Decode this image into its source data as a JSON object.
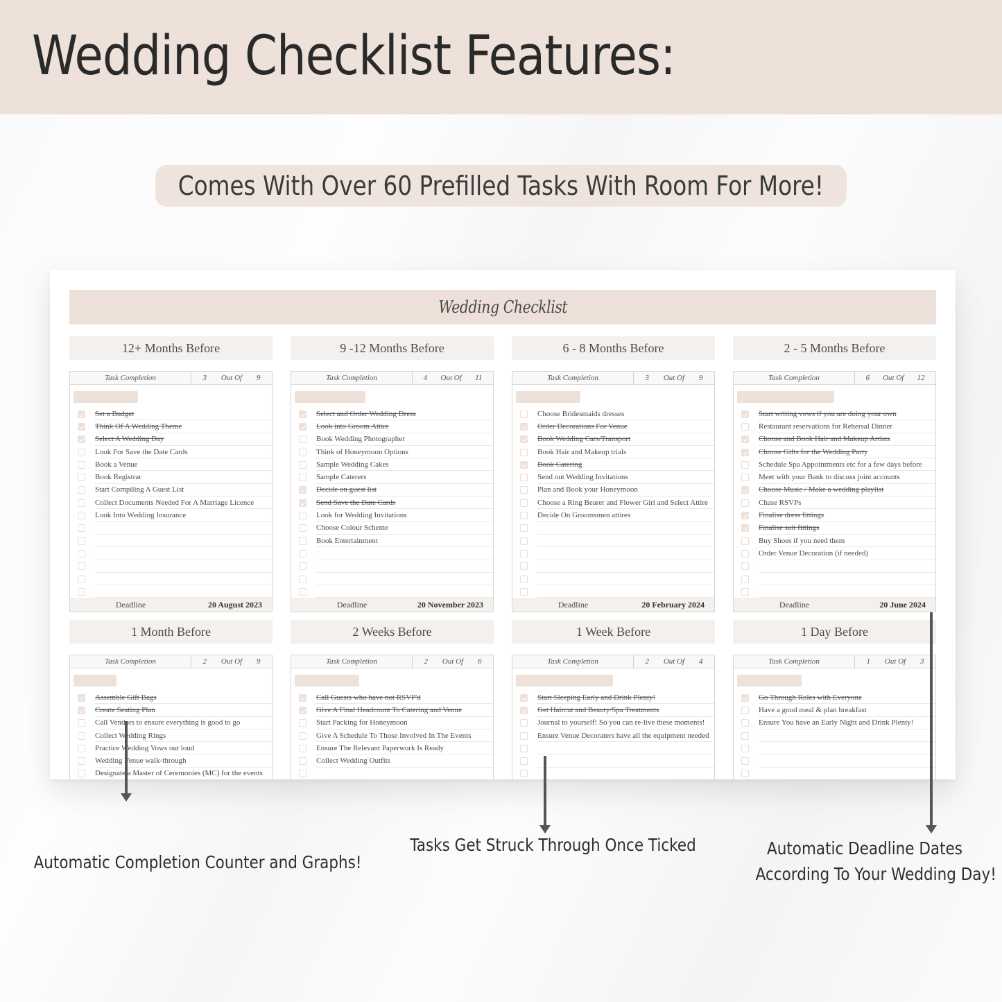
{
  "header": {
    "title": "Wedding Checklist Features:",
    "subtitle": "Comes With Over 60 Prefilled Tasks With Room For More!"
  },
  "sheet": {
    "title": "Wedding Checklist",
    "task_completion_label": "Task Completion",
    "out_of_label": "Out Of",
    "deadline_label": "Deadline",
    "sections": [
      {
        "title": "12+ Months Before",
        "done": 3,
        "total": 9,
        "deadline": "20 August 2023",
        "rows": 15,
        "tasks": [
          {
            "text": "Set a Budget",
            "done": true
          },
          {
            "text": "Think Of A Wedding Theme",
            "done": true
          },
          {
            "text": "Select A Wedding Day",
            "done": true
          },
          {
            "text": "Look For Save the Date Cards",
            "done": false
          },
          {
            "text": "Book a Venue",
            "done": false
          },
          {
            "text": "Book Registrar",
            "done": false
          },
          {
            "text": "Start Compiling A Guest List",
            "done": false
          },
          {
            "text": "Collect Documents Needed For A Marriage Licence",
            "done": false
          },
          {
            "text": "Look Into Wedding Insurance",
            "done": false
          }
        ]
      },
      {
        "title": "9 -12 Months Before",
        "done": 4,
        "total": 11,
        "deadline": "20 November 2023",
        "rows": 15,
        "tasks": [
          {
            "text": "Select and Order Wedding Dress",
            "done": true
          },
          {
            "text": "Look into Groom Attire",
            "done": true
          },
          {
            "text": "Book Wedding Photographer",
            "done": false
          },
          {
            "text": "Think of Honeymoon Options",
            "done": false
          },
          {
            "text": "Sample Wedding Cakes",
            "done": false
          },
          {
            "text": "Sample Caterers",
            "done": false
          },
          {
            "text": "Decide on guest list",
            "done": true
          },
          {
            "text": "Send Save the Date Cards",
            "done": true
          },
          {
            "text": "Look for Wedding Invitations",
            "done": false
          },
          {
            "text": "Choose Colour Scheme",
            "done": false
          },
          {
            "text": "Book Entertainment",
            "done": false
          }
        ]
      },
      {
        "title": "6 - 8 Months Before",
        "done": 3,
        "total": 9,
        "deadline": "20 February 2024",
        "rows": 15,
        "tasks": [
          {
            "text": "Choose Bridesmaids dresses",
            "done": false
          },
          {
            "text": "Order Decorations For Venue",
            "done": true
          },
          {
            "text": "Book Wedding Cars/Transport",
            "done": true
          },
          {
            "text": "Book Hair and Makeup trials",
            "done": false
          },
          {
            "text": "Book Catering",
            "done": true
          },
          {
            "text": "Send out Wedding Invitations",
            "done": false
          },
          {
            "text": "Plan and Book your Honeymoon",
            "done": false
          },
          {
            "text": "Choose a Ring Bearer and Flower Girl and Select Attire",
            "done": false
          },
          {
            "text": "Decide On Groomsmen attires",
            "done": false
          }
        ]
      },
      {
        "title": "2 - 5 Months Before",
        "done": 6,
        "total": 12,
        "deadline": "20 June 2024",
        "rows": 15,
        "tasks": [
          {
            "text": "Start writing vows if you are doing your own",
            "done": true
          },
          {
            "text": "Restaurant reservations for Rehersal Dinner",
            "done": false
          },
          {
            "text": "Choose and Book Hair and Makeup Artists",
            "done": true
          },
          {
            "text": "Choose Gifts for the Wedding Party",
            "done": true
          },
          {
            "text": "Schedule Spa Appointments etc for a few days before",
            "done": false
          },
          {
            "text": "Meet with your Bank to discuss joint accounts",
            "done": false
          },
          {
            "text": "Choose Music / Make a wedding playlist",
            "done": true
          },
          {
            "text": "Chase RSVPs",
            "done": false
          },
          {
            "text": "Finalise dress fittings",
            "done": true
          },
          {
            "text": "Finalise suit fittings",
            "done": true
          },
          {
            "text": "Buy Shoes if you need them",
            "done": false
          },
          {
            "text": "Order Venue Decoration (if needed)",
            "done": false
          }
        ]
      },
      {
        "title": "1 Month Before",
        "done": 2,
        "total": 9,
        "rows": 7,
        "tasks": [
          {
            "text": "Assemble Gift Bags",
            "done": true
          },
          {
            "text": "Create Seating Plan",
            "done": true
          },
          {
            "text": "Call Vendors to ensure everything is good to go",
            "done": false
          },
          {
            "text": "Collect Wedding Rings",
            "done": false
          },
          {
            "text": "Practice Wedding Vows out loud",
            "done": false
          },
          {
            "text": "Wedding Venue walk-through",
            "done": false
          },
          {
            "text": "Designate a Master of Ceremonies (MC) for the events",
            "done": false
          }
        ]
      },
      {
        "title": "2 Weeks Before",
        "done": 2,
        "total": 6,
        "rows": 7,
        "tasks": [
          {
            "text": "Call Guests who have not RSVP'd",
            "done": true
          },
          {
            "text": "Give A Final Headcount To Catering and Venue",
            "done": true
          },
          {
            "text": "Start Packing for Honeymoon",
            "done": false
          },
          {
            "text": "Give A Schedule To Those Involved In The Events",
            "done": false
          },
          {
            "text": "Ensure The Relevant Paperwork Is Ready",
            "done": false
          },
          {
            "text": "Collect Wedding Outfits",
            "done": false
          }
        ]
      },
      {
        "title": "1 Week Before",
        "done": 2,
        "total": 4,
        "rows": 7,
        "tasks": [
          {
            "text": "Start Sleeping Early and Drink Plenty!",
            "done": true
          },
          {
            "text": "Get Haircut and Beauty/Spa Treatments",
            "done": true
          },
          {
            "text": "Journal to yourself! So you can re-live these moments!",
            "done": false
          },
          {
            "text": "Ensure Venue Decoraters have all the equipment needed",
            "done": false
          }
        ]
      },
      {
        "title": "1 Day Before",
        "done": 1,
        "total": 3,
        "rows": 7,
        "tasks": [
          {
            "text": "Go Through Roles with Everyone",
            "done": true
          },
          {
            "text": "Have a good meal & plan breakfast",
            "done": false
          },
          {
            "text": "Ensure You have an Early Night and Drink Plenty!",
            "done": false
          }
        ]
      }
    ]
  },
  "captions": {
    "counter": "Automatic Completion Counter and Graphs!",
    "strike": "Tasks Get Struck Through Once Ticked",
    "deadline_line1": "Automatic Deadline Dates",
    "deadline_line2": "According To Your Wedding Day!"
  }
}
